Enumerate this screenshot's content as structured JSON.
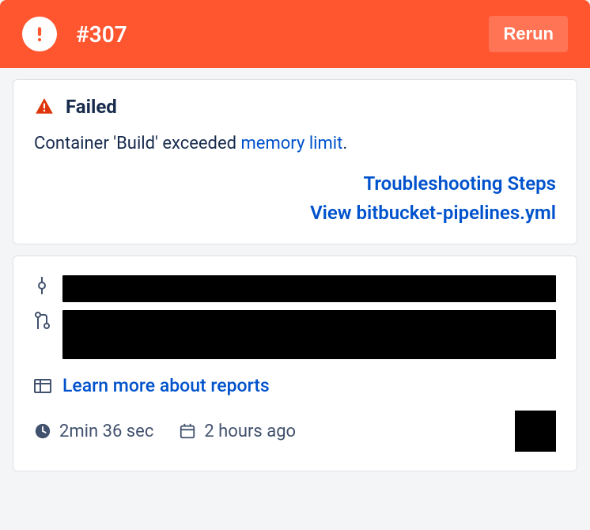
{
  "header": {
    "build_number": "#307",
    "rerun_label": "Rerun"
  },
  "status": {
    "label": "Failed",
    "message_prefix": "Container 'Build' exceeded ",
    "message_link": "memory limit",
    "message_suffix": "."
  },
  "links": {
    "troubleshooting": "Troubleshooting Steps",
    "view_yaml": "View bitbucket-pipelines.yml"
  },
  "reports": {
    "learn_more": "Learn more about reports"
  },
  "footer": {
    "duration": "2min 36 sec",
    "relative_time": "2 hours ago"
  },
  "colors": {
    "header_bg": "#ff5630",
    "link": "#0052cc",
    "text": "#172b4d",
    "fail": "#de350b"
  }
}
